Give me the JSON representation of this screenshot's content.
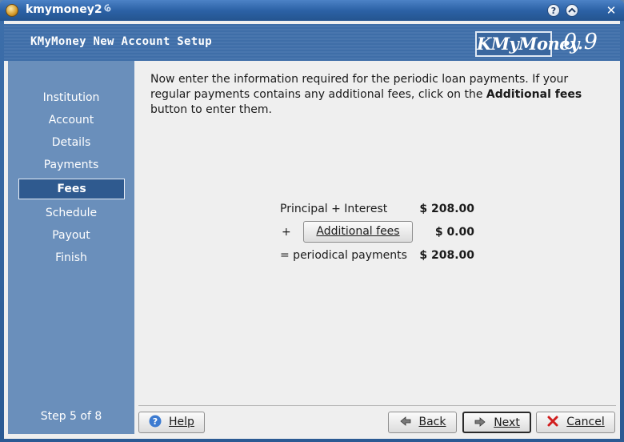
{
  "window": {
    "title": "kmymoney2"
  },
  "header": {
    "title": "KMyMoney New Account Setup",
    "logo": "KMyMoney",
    "version": "0.9"
  },
  "sidebar": {
    "steps": [
      {
        "label": "Institution"
      },
      {
        "label": "Account"
      },
      {
        "label": "Details"
      },
      {
        "label": "Payments"
      },
      {
        "label": "Fees",
        "active": true
      },
      {
        "label": "Schedule"
      },
      {
        "label": "Payout"
      },
      {
        "label": "Finish"
      }
    ],
    "step_count": "Step 5 of 8"
  },
  "content": {
    "intro_part1": "Now enter the information required for the periodic loan payments. If your regular payments contains any additional fees, click on the ",
    "intro_bold": "Additional fees",
    "intro_part2": " button to enter them.",
    "principal_label": "Principal + Interest",
    "principal_value": "$ 208.00",
    "plus_sign": "+",
    "additional_fees_button": "Additional fees",
    "fees_value": "$ 0.00",
    "periodical_label": "= periodical payments",
    "periodical_value": "$ 208.00"
  },
  "buttons": {
    "help": "Help",
    "back": "Back",
    "next": "Next",
    "cancel": "Cancel"
  },
  "colors": {
    "titlebar": "#2c62a6",
    "sidebar": "#6a8fbb",
    "active_step": "#2f5a8f",
    "content_bg": "#efefef"
  }
}
